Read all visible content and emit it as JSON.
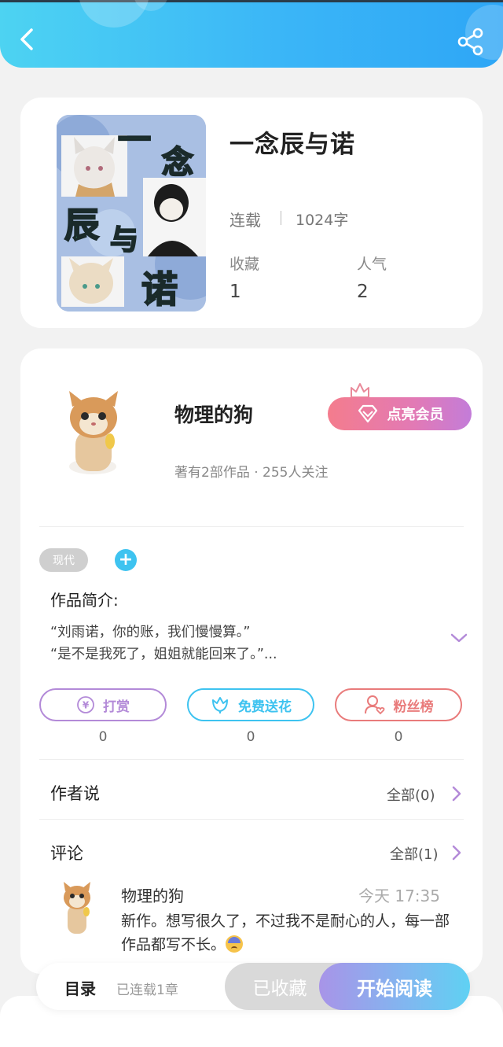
{
  "colors": {
    "header_gradient": [
      "#4dd3f2",
      "#2ea6f6"
    ],
    "reward": "#b38ad8",
    "flower": "#3ec3f0",
    "fans": "#e97b7b",
    "vip_gradient": [
      "#f47c8d",
      "#c37cd9"
    ],
    "read_gradient": [
      "#a894e8",
      "#5fd1f3"
    ]
  },
  "header": {
    "back_icon": "back-arrow-icon",
    "share_icon": "share-icon"
  },
  "book": {
    "cover_title_chars": [
      "一",
      "念",
      "辰",
      "与",
      "诺"
    ],
    "title": "一念辰与诺",
    "status": "连载",
    "words": "1024字",
    "favorites_label": "收藏",
    "favorites_value": "1",
    "popularity_label": "人气",
    "popularity_value": "2"
  },
  "author": {
    "name": "物理的狗",
    "meta": "著有2部作品 · 255人关注",
    "vip_button": "点亮会员"
  },
  "tags": {
    "genre": "现代",
    "add": "+"
  },
  "intro": {
    "label": "作品简介:",
    "line1": "“刘雨诺，你的账，我们慢慢算。”",
    "line2": "“是不是我死了，姐姐就能回来了。”..."
  },
  "actions": [
    {
      "label": "打赏",
      "count": "0",
      "icon": "yen-coin-icon"
    },
    {
      "label": "免费送花",
      "count": "0",
      "icon": "flower-icon"
    },
    {
      "label": "粉丝榜",
      "count": "0",
      "icon": "fan-user-icon"
    }
  ],
  "author_says": {
    "title": "作者说",
    "all": "全部(0)"
  },
  "comments": {
    "title": "评论",
    "all": "全部(1)",
    "items": [
      {
        "user": "物理的狗",
        "time": "今天 17:35",
        "text": "新作。想写很久了，不过我不是耐心的人，每一部作品都写不长。"
      }
    ]
  },
  "bottom_bar": {
    "toc": "目录",
    "toc_sub": "已连载1章",
    "collected": "已收藏",
    "read": "开始阅读"
  }
}
